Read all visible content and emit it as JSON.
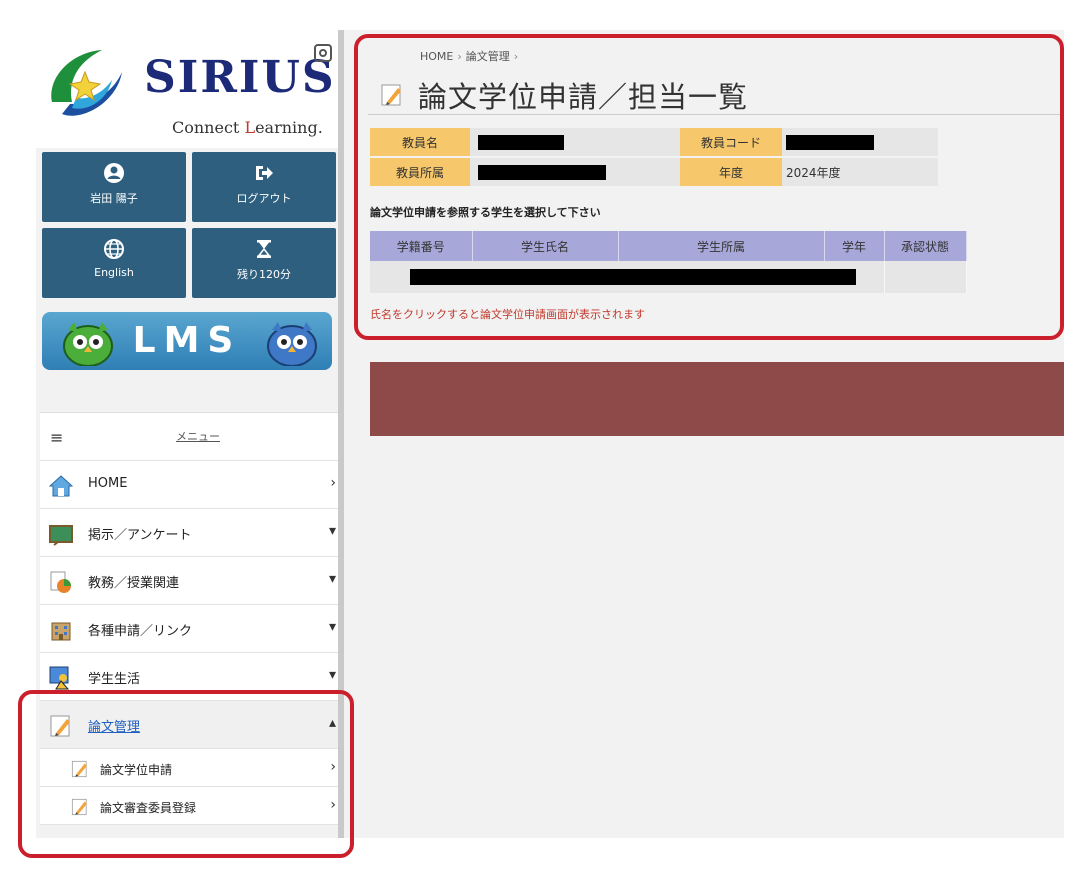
{
  "logo": {
    "brand": "SIRIUS",
    "tagline_prefix": "Connect ",
    "tagline_highlight": "L",
    "tagline_suffix": "earning."
  },
  "user_tiles": [
    {
      "label": "岩田 陽子",
      "icon": "user-icon"
    },
    {
      "label": "ログアウト",
      "icon": "logout-icon"
    },
    {
      "label": "English",
      "icon": "globe-icon"
    },
    {
      "label": "残り120分",
      "icon": "hourglass-icon"
    }
  ],
  "lms": {
    "label": "LMS"
  },
  "menu": {
    "header": "メニュー",
    "items": [
      {
        "label": "HOME",
        "icon": "home-icon",
        "arrow": "›"
      },
      {
        "label": "掲示／アンケート",
        "icon": "board-icon",
        "arrow": "▾"
      },
      {
        "label": "教務／授業関連",
        "icon": "chart-icon",
        "arrow": "▾"
      },
      {
        "label": "各種申請／リンク",
        "icon": "building-icon",
        "arrow": "▾"
      },
      {
        "label": "学生生活",
        "icon": "student-icon",
        "arrow": "▾"
      },
      {
        "label": "論文管理",
        "icon": "pencil-icon",
        "arrow": "▴"
      }
    ],
    "subitems": [
      {
        "label": "論文学位申請",
        "arrow": "›"
      },
      {
        "label": "論文審査委員登録",
        "arrow": "›"
      }
    ]
  },
  "breadcrumb": {
    "home": "HOME",
    "section": "論文管理",
    "sep": "›"
  },
  "page_title": "論文学位申請／担当一覧",
  "info": {
    "teacher_name_label": "教員名",
    "teacher_code_label": "教員コード",
    "teacher_dept_label": "教員所属",
    "year_label": "年度",
    "year_value": "2024年度"
  },
  "instruction": "論文学位申請を参照する学生を選択して下さい",
  "students_table": {
    "headers": [
      "学籍番号",
      "学生氏名",
      "学生所属",
      "学年",
      "承認状態"
    ]
  },
  "note": "氏名をクリックすると論文学位申請画面が表示されます",
  "colors": {
    "tile_bg": "#2e5f7f",
    "label_bg": "#f6c76b",
    "table_header_bg": "#a8a7d9",
    "panel_bar": "#8d4a48",
    "highlight_border": "#cc1f2c",
    "note_text": "#c0392b"
  }
}
